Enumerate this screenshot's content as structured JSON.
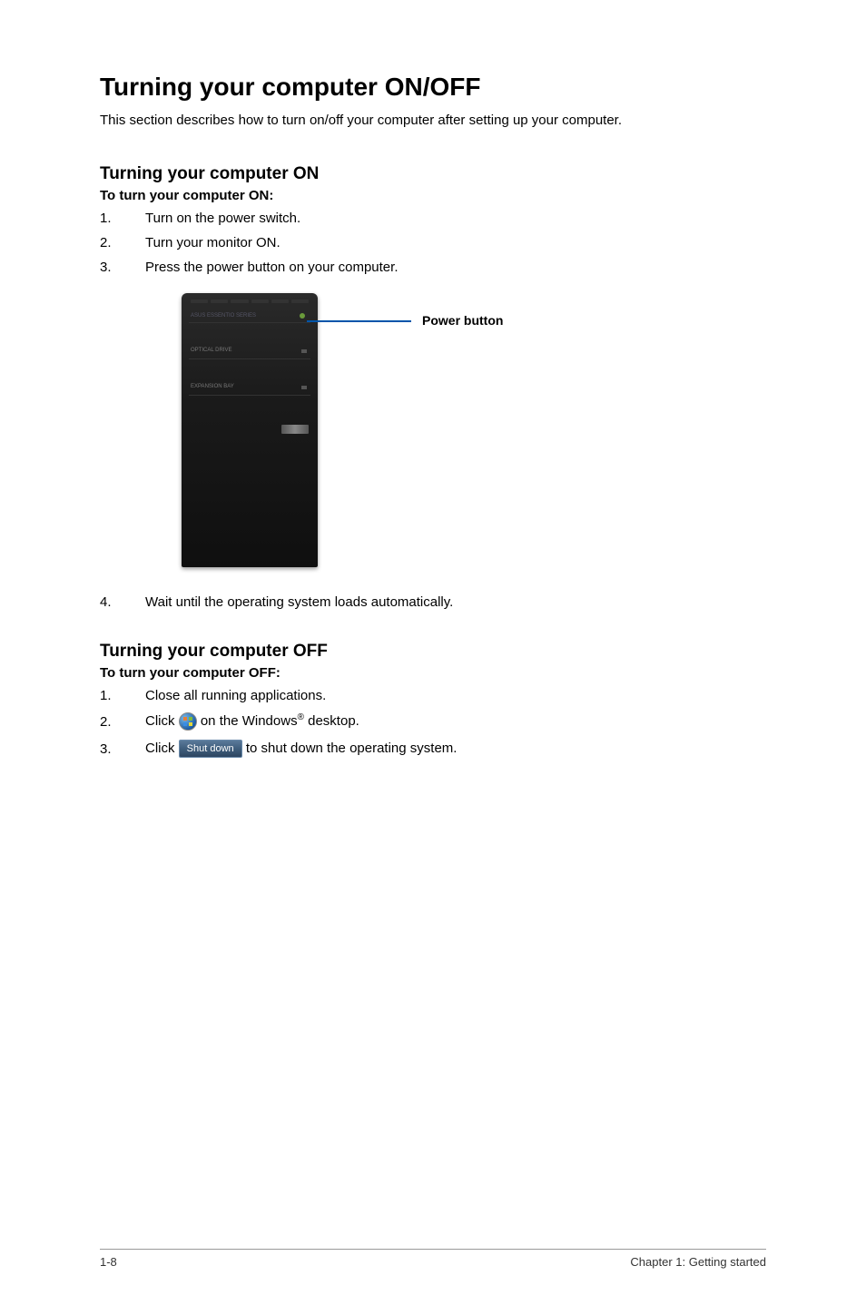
{
  "title": "Turning your computer ON/OFF",
  "intro": "This section describes how to turn on/off your computer after setting up your computer.",
  "section_on": {
    "heading": "Turning your computer ON",
    "subheading": "To turn your computer ON:",
    "steps": {
      "s1_num": "1.",
      "s1_text": "Turn on the power switch.",
      "s2_num": "2.",
      "s2_text": "Turn your monitor ON.",
      "s3_num": "3.",
      "s3_text": "Press the power button on your computer.",
      "s4_num": "4.",
      "s4_text": "Wait until the operating system loads automatically."
    }
  },
  "figure": {
    "callout": "Power button",
    "tower_label1": "ASUS ESSENTIO SERIES",
    "tower_label2": "OPTICAL DRIVE",
    "tower_label3": "EXPANSION BAY"
  },
  "section_off": {
    "heading": "Turning your computer OFF",
    "subheading": "To turn your computer OFF:",
    "steps": {
      "s1_num": "1.",
      "s1_text": "Close all running applications.",
      "s2_num": "2.",
      "s2_pre": "Click ",
      "s2_post_a": " on the Windows",
      "s2_post_b": " desktop.",
      "s3_num": "3.",
      "s3_pre": "Click ",
      "s3_btn": "Shut down",
      "s3_post": " to shut down the operating system."
    }
  },
  "footer": {
    "left": "1-8",
    "right": "Chapter 1: Getting started"
  }
}
